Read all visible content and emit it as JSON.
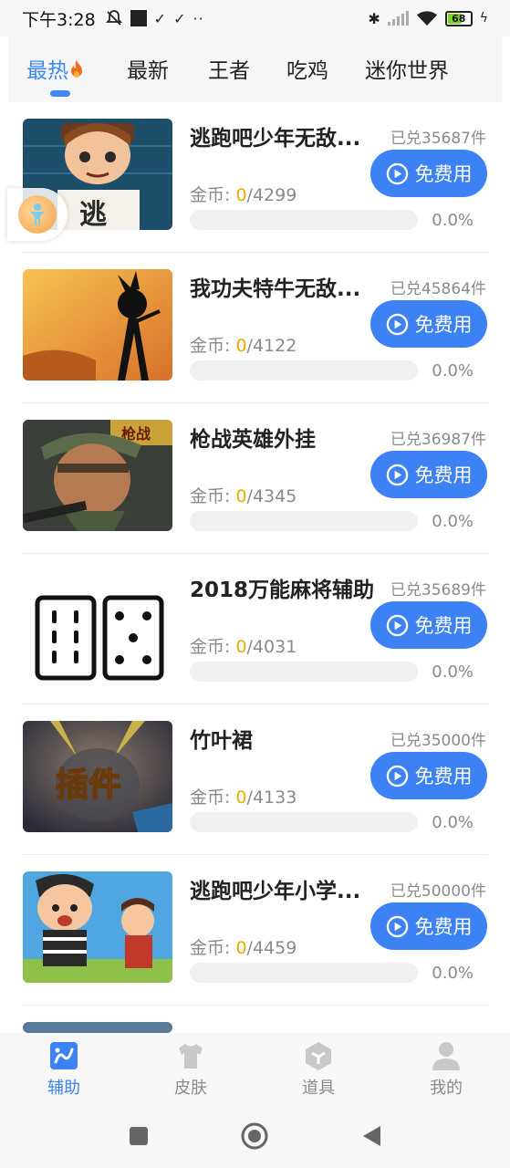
{
  "status_bar": {
    "time": "下午3:28",
    "battery_level": "68",
    "battery_color": "#7ed321"
  },
  "tabs": [
    {
      "label": "最热",
      "active": true
    },
    {
      "label": "最新",
      "active": false
    },
    {
      "label": "王者",
      "active": false
    },
    {
      "label": "吃鸡",
      "active": false
    },
    {
      "label": "迷你世界",
      "active": false
    }
  ],
  "accent_color": "#3d82f5",
  "coin_label": "金币: ",
  "free_button_label": "免费用",
  "items": [
    {
      "title": "逃跑吧少年无敌...",
      "sold": "已兑35687件",
      "coins_current": "0",
      "coins_total": "/4299",
      "progress_text": "0.0%",
      "progress": 0.0
    },
    {
      "title": "我功夫特牛无敌...",
      "sold": "已兑45864件",
      "coins_current": "0",
      "coins_total": "/4122",
      "progress_text": "0.0%",
      "progress": 0.0
    },
    {
      "title": "枪战英雄外挂",
      "sold": "已兑36987件",
      "coins_current": "0",
      "coins_total": "/4345",
      "progress_text": "0.0%",
      "progress": 0.0
    },
    {
      "title": "2018万能麻将辅助",
      "sold": "已兑35689件",
      "coins_current": "0",
      "coins_total": "/4031",
      "progress_text": "0.0%",
      "progress": 0.0
    },
    {
      "title": "竹叶裙",
      "sold": "已兑35000件",
      "coins_current": "0",
      "coins_total": "/4133",
      "progress_text": "0.0%",
      "progress": 0.0
    },
    {
      "title": "逃跑吧少年小学...",
      "sold": "已兑50000件",
      "coins_current": "0",
      "coins_total": "/4459",
      "progress_text": "0.0%",
      "progress": 0.0
    }
  ],
  "thumb_texts": {
    "escape": "逃",
    "plugin": "插件",
    "war": "枪战"
  },
  "bottom_nav": [
    {
      "label": "辅助",
      "icon": "assist-icon",
      "active": true
    },
    {
      "label": "皮肤",
      "icon": "shirt-icon",
      "active": false
    },
    {
      "label": "道具",
      "icon": "box-icon",
      "active": false
    },
    {
      "label": "我的",
      "icon": "profile-icon",
      "active": false
    }
  ]
}
